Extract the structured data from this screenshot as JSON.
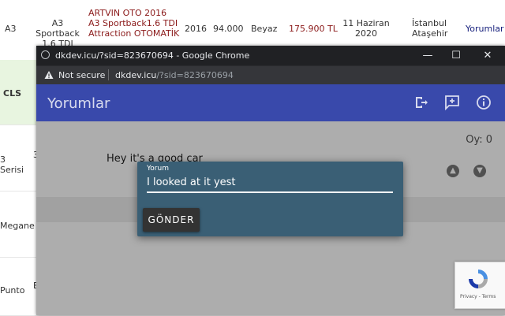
{
  "background_table": {
    "top_row": {
      "model": "A3",
      "series": "A3 Sportback 1.6 TDI",
      "listing_title": "ARTVIN OTO 2016 A3 Sportback1.6 TDI Attraction OTOMATİK",
      "year": "2016",
      "km": "94.000",
      "color": "Beyaz",
      "price": "175.900 TL",
      "date": "11 Haziran 2020",
      "location": "İstanbul Ataşehir",
      "link": "Yorumlar"
    },
    "left_labels": [
      "CLS",
      "3 Serisi",
      "Megane",
      "Punto"
    ],
    "partial_cells": [
      "3",
      "B"
    ]
  },
  "chrome": {
    "title": "dkdev.icu/?sid=823670694 - Google Chrome",
    "not_secure": "Not secure",
    "url_domain": "dkdev.icu",
    "url_path": "/?sid=823670694",
    "minimize": "—",
    "maximize": "☐",
    "close": "✕"
  },
  "app": {
    "title": "Yorumlar",
    "icons": [
      "logout-icon",
      "add-comment-icon",
      "info-icon"
    ],
    "comment": "Hey it's a good car",
    "score_label": "Oy: 0"
  },
  "dialog": {
    "field_label": "Yorum",
    "field_value": "I looked at it yest",
    "send_label": "GÖNDER"
  },
  "recaptcha": {
    "text": "Privacy - Terms"
  },
  "colors": {
    "appbar": "#3949ab",
    "dialog": "#3a5f75",
    "price": "#8b1a1a",
    "link": "#1a237e",
    "cls_row": "#e8f5e0"
  }
}
